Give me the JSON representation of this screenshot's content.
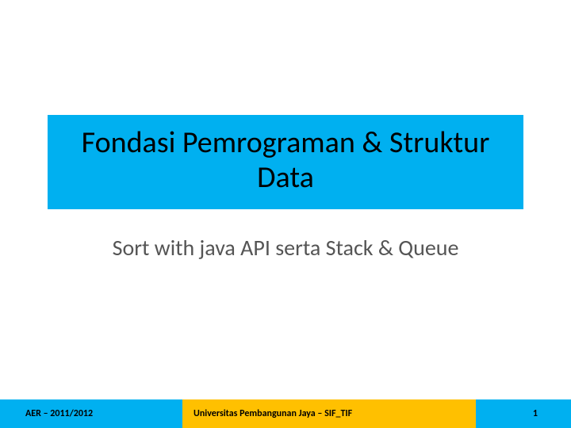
{
  "title": "Fondasi Pemrograman & Struktur Data",
  "subtitle": "Sort with java API serta Stack & Queue",
  "footer": {
    "left": "AER – 2011/2012",
    "center": "Universitas Pembangunan Jaya – SIF_TIF",
    "page": "1"
  }
}
